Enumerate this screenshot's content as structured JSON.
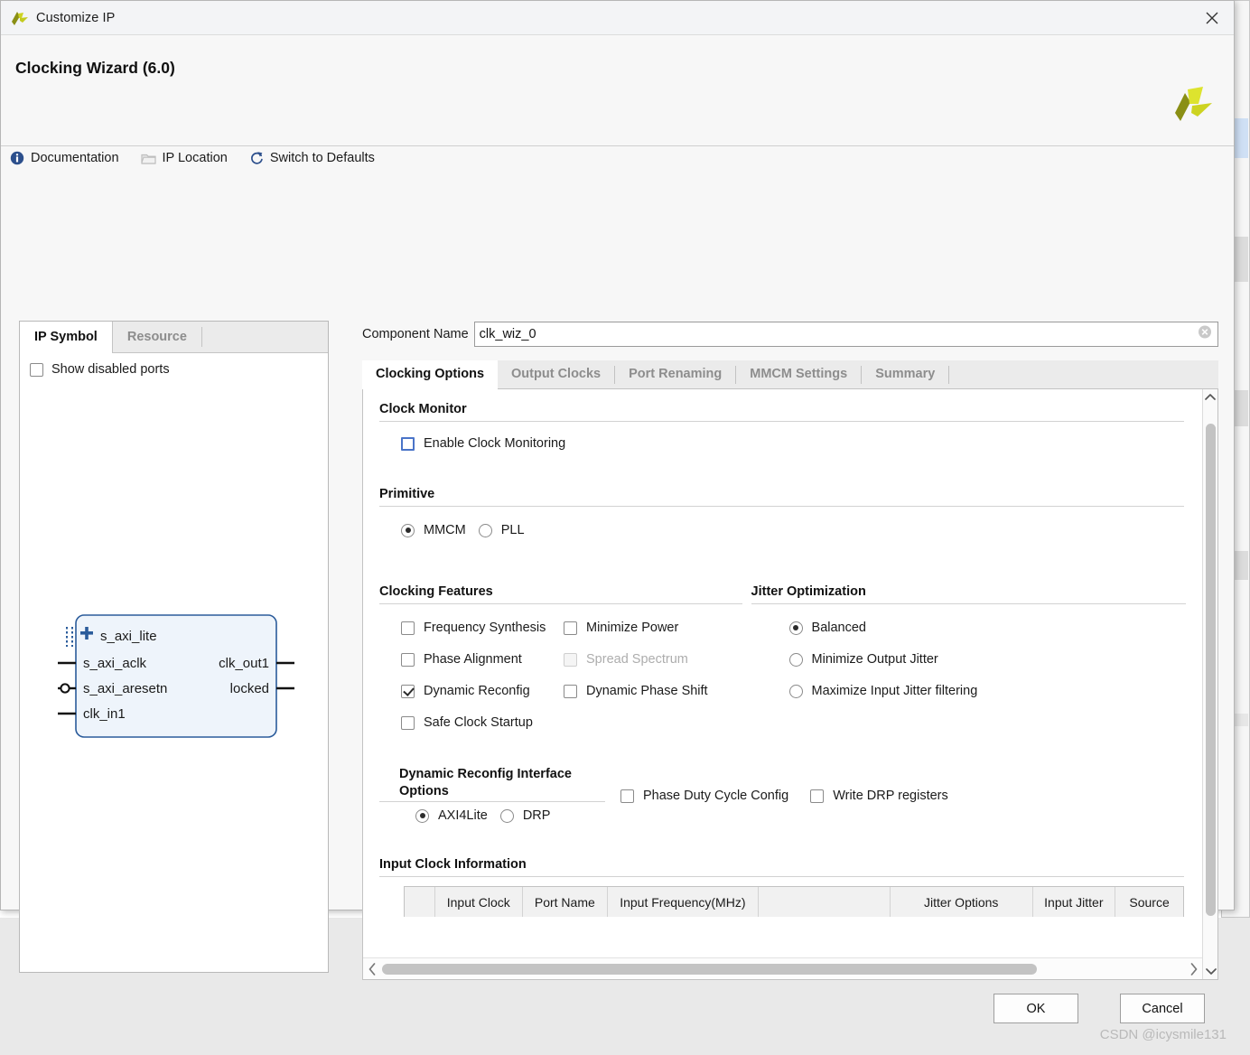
{
  "window": {
    "title": "Customize IP",
    "close_icon": "close-icon",
    "app_logo_icon": "xilinx-logo-icon"
  },
  "header": {
    "ip_title": "Clocking Wizard (6.0)",
    "brand_logo_icon": "amd-xilinx-pinwheel-logo",
    "toolbar": [
      {
        "label": "Documentation",
        "icon": "info-circle-icon"
      },
      {
        "label": "IP Location",
        "icon": "folder-icon"
      },
      {
        "label": "Switch to Defaults",
        "icon": "refresh-icon"
      }
    ]
  },
  "left_panel": {
    "tabs": [
      {
        "label": "IP Symbol",
        "active": true
      },
      {
        "label": "Resource",
        "active": false
      }
    ],
    "show_disabled_ports": {
      "label": "Show disabled ports",
      "checked": false
    },
    "symbol": {
      "bus_port": "s_axi_lite",
      "left_ports": [
        "s_axi_aclk",
        "s_axi_aresetn",
        "clk_in1"
      ],
      "right_ports": [
        "clk_out1",
        "locked"
      ]
    }
  },
  "component": {
    "label": "Component Name",
    "value": "clk_wiz_0",
    "clear_icon": "clear-circle-icon"
  },
  "tabs": [
    {
      "label": "Clocking Options",
      "active": true
    },
    {
      "label": "Output Clocks",
      "active": false
    },
    {
      "label": "Port Renaming",
      "active": false
    },
    {
      "label": "MMCM Settings",
      "active": false
    },
    {
      "label": "Summary",
      "active": false
    }
  ],
  "sections": {
    "clock_monitor": {
      "title": "Clock Monitor",
      "enable_clock_monitoring": {
        "label": "Enable Clock Monitoring",
        "checked": false,
        "focused": true
      }
    },
    "primitive": {
      "title": "Primitive",
      "options": [
        {
          "label": "MMCM",
          "selected": true
        },
        {
          "label": "PLL",
          "selected": false
        }
      ]
    },
    "clocking_features": {
      "title": "Clocking Features",
      "column1": [
        {
          "label": "Frequency Synthesis",
          "checked": false,
          "disabled": false
        },
        {
          "label": "Phase Alignment",
          "checked": false,
          "disabled": false
        },
        {
          "label": "Dynamic Reconfig",
          "checked": true,
          "disabled": false
        },
        {
          "label": "Safe Clock Startup",
          "checked": false,
          "disabled": false
        }
      ],
      "column2": [
        {
          "label": "Minimize Power",
          "checked": false,
          "disabled": false
        },
        {
          "label": "Spread Spectrum",
          "checked": false,
          "disabled": true
        },
        {
          "label": "Dynamic Phase Shift",
          "checked": false,
          "disabled": false
        }
      ]
    },
    "jitter_optimization": {
      "title": "Jitter Optimization",
      "options": [
        {
          "label": "Balanced",
          "selected": true
        },
        {
          "label": "Minimize Output Jitter",
          "selected": false
        },
        {
          "label": "Maximize Input Jitter filtering",
          "selected": false
        }
      ]
    },
    "dynamic_reconfig": {
      "title_line1": "Dynamic Reconfig Interface",
      "title_line2": "Options",
      "interface_options": [
        {
          "label": "AXI4Lite",
          "selected": true
        },
        {
          "label": "DRP",
          "selected": false
        }
      ],
      "extra_checkboxes": [
        {
          "label": "Phase Duty Cycle Config",
          "checked": false
        },
        {
          "label": "Write DRP registers",
          "checked": false
        }
      ]
    },
    "input_clock_information": {
      "title": "Input Clock Information",
      "columns": [
        "",
        "Input Clock",
        "Port Name",
        "Input Frequency(MHz)",
        "",
        "Jitter Options",
        "Input Jitter",
        "Source"
      ],
      "rows": []
    }
  },
  "footer": {
    "ok_label": "OK",
    "cancel_label": "Cancel"
  },
  "watermark": "CSDN @icysmile131",
  "colors": {
    "accent_blue": "#4a74c8",
    "link_icon_blue": "#2c4f8c",
    "logo_yellow": "#d9de2a",
    "logo_olive": "#7d8412",
    "symbol_fill": "#eef4fb",
    "symbol_border": "#2b5c9b"
  }
}
